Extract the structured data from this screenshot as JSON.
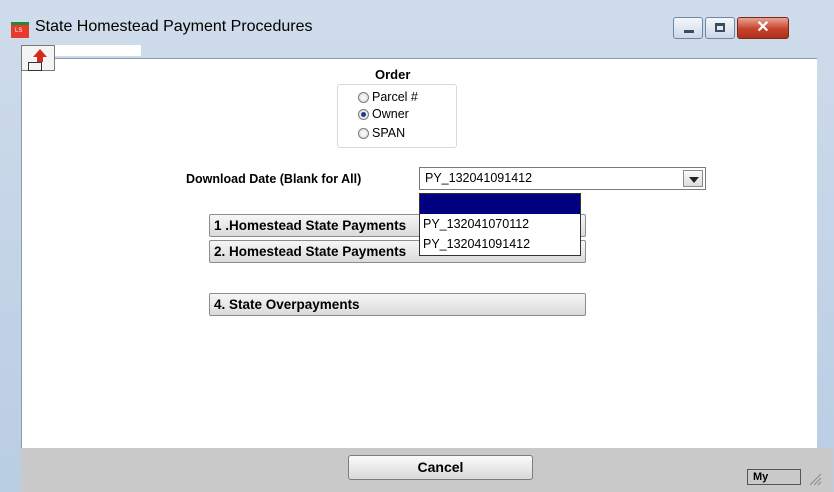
{
  "window": {
    "title": "State Homestead Payment Procedures",
    "app_icon_text": "LS"
  },
  "order": {
    "label": "Order",
    "options": [
      {
        "label": "Parcel #",
        "checked": false
      },
      {
        "label": "Owner",
        "checked": true
      },
      {
        "label": "SPAN",
        "checked": false
      }
    ]
  },
  "download_date": {
    "label": "Download Date (Blank for All)",
    "value": "PY_132041091412",
    "options": [
      "",
      "PY_132041070112",
      "PY_132041091412"
    ]
  },
  "actions": [
    {
      "label": "1 .Homestead State Payments"
    },
    {
      "label": "2. Homestead State Payments"
    },
    {
      "label": "4. State Overpayments"
    }
  ],
  "footer": {
    "cancel_label": "Cancel",
    "status_text": "My"
  }
}
